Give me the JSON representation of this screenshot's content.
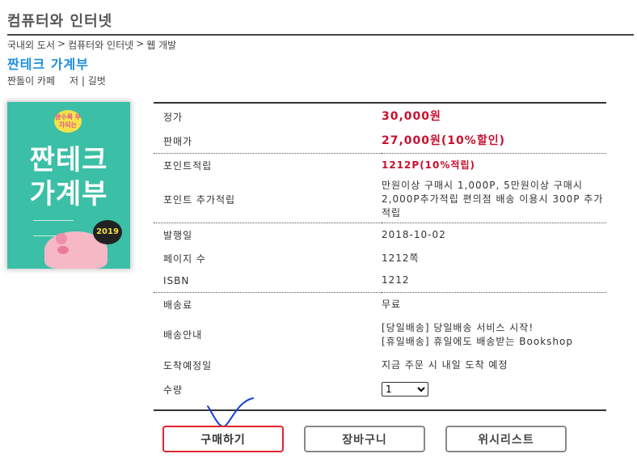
{
  "category_title": "컴퓨터와 인터넷",
  "breadcrumb": [
    "국내외 도서",
    ">",
    "컴퓨터와 인터넷",
    ">",
    "웹 개발"
  ],
  "book": {
    "title": "짠테크 가계부",
    "publisher": "짠돌이 카페",
    "author": "저 | 길벗",
    "cover": {
      "tag": "쓸수록 부자되는",
      "line1": "짠테크",
      "line2": "가계부",
      "year": "2019"
    }
  },
  "info": {
    "list_price_label": "정가",
    "list_price": "30,000원",
    "sale_price_label": "판매가",
    "sale_price": "27,000원(10%할인)",
    "points_label": "포인트적립",
    "points": "1212P(10%적립)",
    "extra_points_label": "포인트 추가적립",
    "extra_points": "만원이상 구매시 1,000P, 5만원이상 구매시 2,000P추가적립 편의점 배송 이용시 300P 추가적립",
    "pub_date_label": "발행일",
    "pub_date": "2018-10-02",
    "pages_label": "페이지 수",
    "pages": "1212쪽",
    "isbn_label": "ISBN",
    "isbn": "1212",
    "shipping_fee_label": "배송료",
    "shipping_fee": "무료",
    "shipping_info_label": "배송안내",
    "shipping_info_1": "[당일배송] 당일배송 서비스 시작!",
    "shipping_info_2": "[휴일배송] 휴일에도 배송받는 Bookshop",
    "arrival_label": "도착예정일",
    "arrival": "지금 주문 시 내일 도착 예정",
    "qty_label": "수량",
    "qty_value": "1"
  },
  "buttons": {
    "buy": "구매하기",
    "cart": "장바구니",
    "wishlist": "위시리스트"
  },
  "colors": {
    "accent_title": "#1f8fe0",
    "price": "#c8102e",
    "buy_border": "#e0242e",
    "scribble": "#1a3fd1"
  }
}
